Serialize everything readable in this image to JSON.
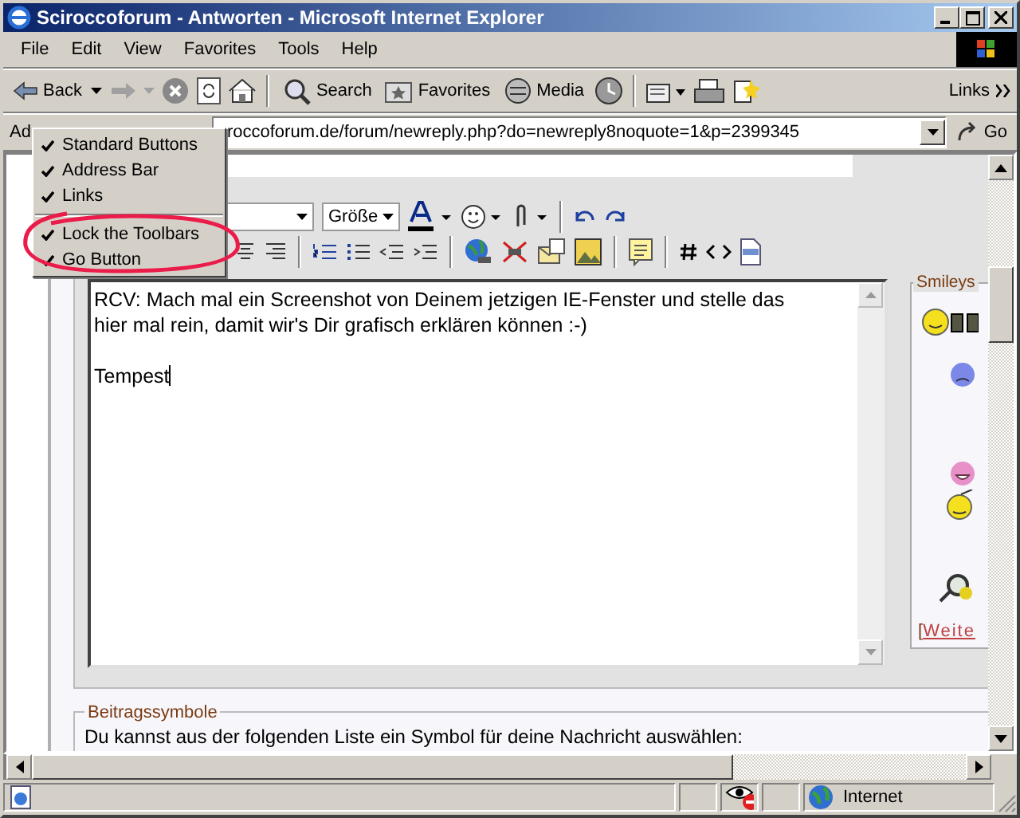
{
  "window": {
    "title": "Sciroccoforum - Antworten - Microsoft Internet Explorer"
  },
  "menu": [
    "File",
    "Edit",
    "View",
    "Favorites",
    "Tools",
    "Help"
  ],
  "toolbar": {
    "back": "Back",
    "search": "Search",
    "favorites": "Favorites",
    "media": "Media",
    "links": "Links"
  },
  "address": {
    "label": "Ad",
    "url": "roccoforum.de/forum/newreply.php?do=newreply8noquote=1&p=2399345",
    "go": "Go"
  },
  "context_menu": [
    {
      "kind": "item",
      "label": "Standard Buttons",
      "checked": true
    },
    {
      "kind": "item",
      "label": "Address Bar",
      "checked": true
    },
    {
      "kind": "item",
      "label": "Links",
      "checked": true
    },
    {
      "kind": "separator"
    },
    {
      "kind": "item",
      "label": "Lock the Toolbars",
      "checked": true
    },
    {
      "kind": "item",
      "label": "Go Button",
      "checked": true
    }
  ],
  "editor": {
    "size_select": "Größe",
    "paragraphs": [
      [
        "RCV: Mach mal ein Screenshot von Deinem jetzigen IE-Fenster und stelle das",
        "hier mal rein, damit wir's Dir grafisch erklären können :-)"
      ],
      [
        "Tempest"
      ]
    ]
  },
  "smileys": {
    "legend": "Smileys",
    "bracket": "[",
    "more_link": "Weite"
  },
  "post_icons": {
    "legend": "Beitragssymbole",
    "text": "Du kannst aus der folgenden Liste ein Symbol für deine Nachricht auswählen:"
  },
  "status_bar": {
    "zone": "Internet"
  }
}
